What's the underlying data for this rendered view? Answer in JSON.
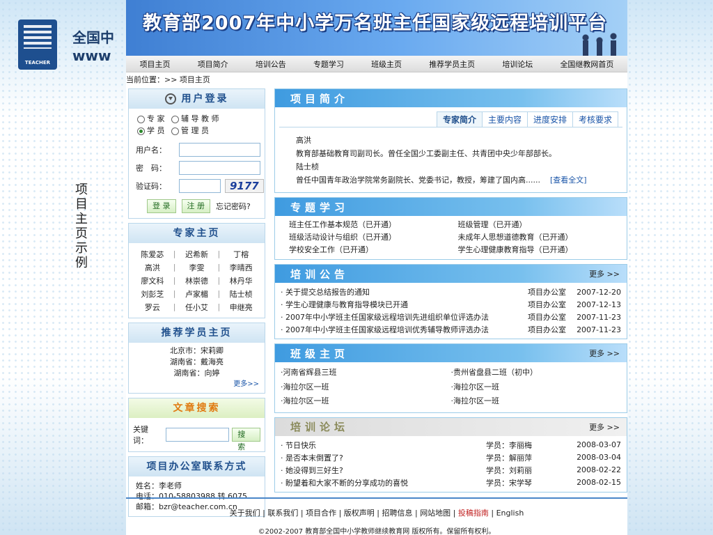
{
  "brand": {
    "line1": "全国中",
    "line2": "www",
    "logo_text": "TEACHER"
  },
  "side_caption": "项目主页示例",
  "banner_title": "教育部2007年中小学万名班主任国家级远程培训平台",
  "nav": [
    "项目主页",
    "项目简介",
    "培训公告",
    "专题学习",
    "班级主页",
    "推荐学员主页",
    "培训论坛",
    "全国继教网首页"
  ],
  "breadcrumb": "当前位置：>> 项目主页",
  "login": {
    "title": "用户登录",
    "roles": [
      "专 家",
      "辅 导 教 师",
      "学 员",
      "管 理 员"
    ],
    "selected": "学 员",
    "username_label": "用户名：",
    "password_label": "密　码：",
    "captcha_label": "验证码：",
    "captcha": "9177",
    "login_btn": "登 录",
    "register_btn": "注 册",
    "forgot": "忘记密码?"
  },
  "experts": {
    "title": "专家主页",
    "rows": [
      [
        "陈爱苾",
        "迟希新",
        "丁榕"
      ],
      [
        "高洪",
        "李雯",
        "李晴西"
      ],
      [
        "廖文科",
        "林崇德",
        "林丹华"
      ],
      [
        "刘彭芝",
        "卢家楣",
        "陆士桢"
      ],
      [
        "罗云",
        "任小艾",
        "申继亮"
      ]
    ]
  },
  "recommend": {
    "title": "推荐学员主页",
    "items": [
      "北京市：宋莉卿",
      "湖南省：戴海亮",
      "湖南省：向婷"
    ],
    "more": "更多>>"
  },
  "search": {
    "title": "文章搜索",
    "label": "关键词：",
    "button": "搜 索"
  },
  "contact": {
    "title": "项目办公室联系方式",
    "name": "姓名：李老师",
    "phone": "电话：010-58803988 转 6075",
    "email": "邮箱：bzr@teacher.com.cn"
  },
  "intro": {
    "title": "项目简介",
    "tabs": [
      "专家简介",
      "主要内容",
      "进度安排",
      "考核要求"
    ],
    "lines": [
      "高洪",
      "教育部基础教育司副司长。曾任全国少工委副主任、共青团中央少年部部长。",
      "陆士桢",
      "曾任中国青年政治学院常务副院长、党委书记，教授，筹建了国内高......"
    ],
    "link": "[查看全文]"
  },
  "topics": {
    "title": "专题学习",
    "items": [
      "班主任工作基本规范（已开通）",
      "班级管理（已开通）",
      "班级活动设计与组织（已开通）",
      "未成年人思想道德教育（已开通）",
      "学校安全工作（已开通）",
      "学生心理健康教育指导（已开通）"
    ]
  },
  "notices": {
    "title": "培训公告",
    "more": "更多 >>",
    "rows": [
      {
        "t": "· 关于提交总结报告的通知",
        "f": "项目办公室",
        "d": "2007-12-20"
      },
      {
        "t": "· 学生心理健康与教育指导模块已开通",
        "f": "项目办公室",
        "d": "2007-12-13"
      },
      {
        "t": "· 2007年中小学班主任国家级远程培训先进组织单位评选办法",
        "f": "项目办公室",
        "d": "2007-11-23"
      },
      {
        "t": "· 2007年中小学班主任国家级远程培训优秀辅导教师评选办法",
        "f": "项目办公室",
        "d": "2007-11-23"
      }
    ]
  },
  "classes": {
    "title": "班级主页",
    "more": "更多 >>",
    "items": [
      "·河南省辉县三班",
      "·贵州省盘县二班（初中）",
      "·海拉尔区一班",
      "·海拉尔区一班",
      "·海拉尔区一班",
      "·海拉尔区一班"
    ]
  },
  "forum": {
    "title": "培训论坛",
    "more": "更多 >>",
    "rows": [
      {
        "t": "· 节日快乐",
        "u": "学员：李丽梅",
        "d": "2008-03-07"
      },
      {
        "t": "· 是否本末倒置了?",
        "u": "学员：解丽萍",
        "d": "2008-03-04"
      },
      {
        "t": "· 她没得到三好生?",
        "u": "学员：刘莉丽",
        "d": "2008-02-22"
      },
      {
        "t": "· 盼望着和大家不断的分享成功的喜悦",
        "u": "学员：宋学琴",
        "d": "2008-02-15"
      }
    ]
  },
  "footer": {
    "links": [
      "关于我们",
      "联系我们",
      "项目合作",
      "版权声明",
      "招聘信息",
      "网站地图",
      "投稿指南",
      "English"
    ],
    "highlight": "投稿指南",
    "copyright": "©2002-2007 教育部全国中小学教师继续教育网 版权所有。保留所有权利。"
  }
}
